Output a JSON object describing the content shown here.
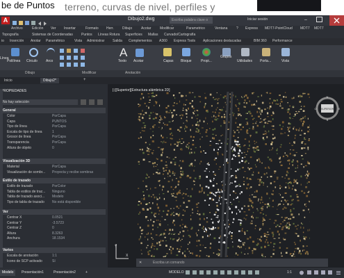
{
  "slide": {
    "title": "be de Puntos",
    "background_text": "terreno, curvas de nivel, perfiles y"
  },
  "window": {
    "app_logo": "A",
    "document_title": "Dibujo2.dwg",
    "search_placeholder": "Escriba palabra clave o frase",
    "sign_in": "Iniciar sesión"
  },
  "menu_row1": [
    "Archivo",
    "Edición",
    "Ver",
    "Insertar",
    "Formato",
    "Herr.",
    "Dibujo",
    "Acotar",
    "Modificar",
    "Parametrico",
    "Ventana",
    "?",
    "Express",
    "MDT7-PointCloud",
    "MDT7",
    "MDT7"
  ],
  "menu_row2": [
    "Topografía",
    "Sistemas de Coordenadas",
    "Puntos",
    "Líneas Rotura",
    "Superficies",
    "Mallas",
    "Curvado/Cartografía"
  ],
  "ribbon_tabs": [
    "io",
    "Inserción",
    "Anotar",
    "Paramétrico",
    "Vista",
    "Administrar",
    "Salida",
    "Complementos",
    "A360",
    "Express Tools",
    "Aplicaciones destacadas",
    "BIM 360",
    "Performance"
  ],
  "ribbon_tools": {
    "polyline": "Polilínea",
    "circle": "Círculo",
    "arc": "Arco",
    "text": "Texto",
    "dimension": "Acotar",
    "layers": "Capas",
    "block": "Bloque",
    "properties": "Propi...",
    "groups": "Grupos",
    "utilities": "Utilidades",
    "clipboard": "Porta...",
    "view": "Vista",
    "line": "Línea"
  },
  "ribbon_panels": [
    "Dibujo",
    "Modificar",
    "Anotación"
  ],
  "doc_tabs": [
    "Inicio",
    "Dibujo2*"
  ],
  "properties": {
    "header": "PROPIEDADES",
    "selection": "No hay selección",
    "sections": [
      {
        "title": "General",
        "rows": [
          [
            "Color",
            "PorCapa"
          ],
          [
            "Capa",
            "PUNTOS"
          ],
          [
            "Tipo de línea",
            "PorCapa"
          ],
          [
            "Escala de tipo de línea",
            "1"
          ],
          [
            "Grosor de línea",
            "PorCapa"
          ],
          [
            "Transparencia",
            "PorCapa"
          ],
          [
            "Altura de objeto",
            "0"
          ]
        ]
      },
      {
        "title": "Visualización 3D",
        "rows": [
          [
            "Material",
            "PorCapa"
          ],
          [
            "Visualización de sombr...",
            "Proyecta y recibe sombras"
          ]
        ]
      },
      {
        "title": "Estilo de trazado",
        "rows": [
          [
            "Estilo de trazado",
            "PorColor"
          ],
          [
            "Tabla de estilos de traz...",
            "Ninguno"
          ],
          [
            "Tabla de trazado asoci...",
            "Modelo"
          ],
          [
            "Tipo de tabla de trazado",
            "No está disponible"
          ]
        ]
      },
      {
        "title": "Ver",
        "rows": [
          [
            "Centrar X",
            "0.0521"
          ],
          [
            "Centrar Y",
            "-3.5723"
          ],
          [
            "Centrar Z",
            "0"
          ],
          [
            "Altura",
            "8.3263"
          ],
          [
            "Anchura",
            "18.1534"
          ]
        ]
      },
      {
        "title": "Varios",
        "rows": [
          [
            "Escala de anotación",
            "1:1"
          ],
          [
            "Icono de SCP activado",
            "Sí"
          ]
        ]
      }
    ]
  },
  "viewport_label": "[-][Superior][Estructura alámbrica 2D]",
  "viewcube_face": "SUPERIOR",
  "compass": {
    "n": "N",
    "s": "S",
    "e": "E",
    "w": "O"
  },
  "command_placeholder": "Escriba un comando",
  "ucs_labels": {
    "x": "X",
    "y": "Y"
  },
  "status": {
    "model_tab": "Modelo",
    "layout_tabs": [
      "Presentación1",
      "Presentación2"
    ],
    "mode": "MODELO",
    "scale": "1:1"
  },
  "colors": {
    "accent_red": "#c41f1f",
    "ribbon": "#3a3d44",
    "canvas": "#1e2024"
  }
}
